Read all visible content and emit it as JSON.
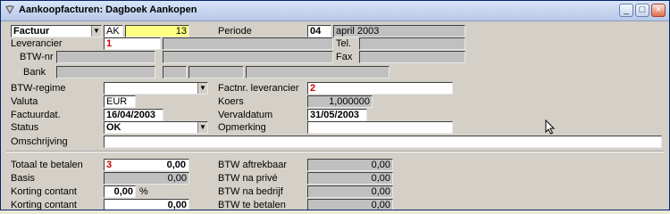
{
  "window": {
    "title": "Aankoopfacturen: Dagboek Aankopen",
    "minimize": "_",
    "maximize": "□",
    "close": "×"
  },
  "header": {
    "doctype": "Factuur",
    "journal_code": "AK",
    "number": "13",
    "periode_label": "Periode",
    "periode_num": "04",
    "periode_text": "april 2003"
  },
  "supplier": {
    "leverancier_label": "Leverancier",
    "leverancier_index": "1",
    "tel_label": "Tel.",
    "btwnr_label": "BTW-nr",
    "fax_label": "Fax",
    "bank_label": "Bank"
  },
  "details": {
    "btwregime_label": "BTW-regime",
    "factnr_label": "Factnr. leverancier",
    "factnr_index": "2",
    "valuta_label": "Valuta",
    "valuta": "EUR",
    "koers_label": "Koers",
    "koers": "1,000000",
    "factuurdat_label": "Factuurdat.",
    "factuurdat": "16/04/2003",
    "vervaldatum_label": "Vervaldatum",
    "vervaldatum": "31/05/2003",
    "status_label": "Status",
    "status": "OK",
    "opmerking_label": "Opmerking",
    "omschrijving_label": "Omschrijving"
  },
  "totals": {
    "totaal_label": "Totaal te betalen",
    "totaal_index": "3",
    "totaal": "0,00",
    "basis_label": "Basis",
    "basis": "0,00",
    "korting_pct_label": "Korting contant",
    "korting_pct": "0,00",
    "pct_sign": "%",
    "korting_label": "Korting contant",
    "korting": "0,00",
    "btw_aftrekbaar_label": "BTW aftrekbaar",
    "btw_aftrekbaar": "0,00",
    "btw_prive_label": "BTW na privé",
    "btw_prive": "0,00",
    "btw_bedrijf_label": "BTW na bedrijf",
    "btw_bedrijf": "0,00",
    "btw_betalen_label": "BTW te betalen",
    "btw_betalen": "0,00"
  }
}
